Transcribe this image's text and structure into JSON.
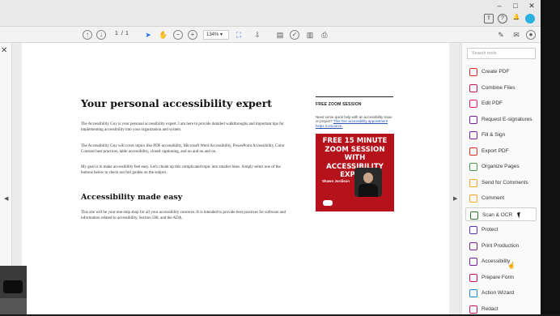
{
  "window": {
    "min": "–",
    "max": "□",
    "close": "✕"
  },
  "topbar_icons": [
    "share-icon",
    "help-icon",
    "bell-icon",
    "account-icon"
  ],
  "toolbar": {
    "page_current": "1",
    "page_sep": "/",
    "page_total": "1",
    "zoom": "134%"
  },
  "document": {
    "title": "Your personal accessibility expert",
    "para1": "The Accessibility Guy is your personal accessibility expert. I am here to provide detailed walkthroughs and important tips for implementing accessibility into your organization and system.",
    "para2": "The Accessibility Guy will cover topics like PDF accessibility, Microsoft Word Accessibility, PowerPoint Accessibility, Color Contrast best practices, table accessibility, closed captioning, and on and on and on.",
    "para3": "My goal is to make accessibility feel easy. Let's chunk up this complicated topic into smaller bites. Simply select one of the buttons below to check out full guides on the subject.",
    "subtitle": "Accessibility made easy",
    "para4": "This site will be your one-stop shop for all your accessibility concerns. It is intended to provide best practices for software and information related to accessibility, Section 508, and the ADA.",
    "side_heading": "FREE ZOOM SESSION",
    "side_text": "Need some quick help with an accessibility issue or project?",
    "side_link": "This free accessibility appointment helps it resource.",
    "promo_text": "FREE 15 MINUTE ZOOM SESSION WITH ACCESSIBILITY EXPERT",
    "promo_name": "Shawn Jordison"
  },
  "tools_panel": {
    "search_placeholder": "Search tools",
    "items": [
      {
        "label": "Create PDF",
        "color": "#d93025"
      },
      {
        "label": "Combine Files",
        "color": "#c2185b"
      },
      {
        "label": "Edit PDF",
        "color": "#e91e63"
      },
      {
        "label": "Request E-signatures",
        "color": "#7b1fa2"
      },
      {
        "label": "Fill & Sign",
        "color": "#7b1fa2"
      },
      {
        "label": "Export PDF",
        "color": "#d93025"
      },
      {
        "label": "Organize Pages",
        "color": "#43a047"
      },
      {
        "label": "Send for Comments",
        "color": "#f9a825"
      },
      {
        "label": "Comment",
        "color": "#f9a825"
      },
      {
        "label": "Scan & OCR",
        "color": "#2e7d32"
      },
      {
        "label": "Protect",
        "color": "#5e35b1"
      },
      {
        "label": "Print Production",
        "color": "#7b1fa2"
      },
      {
        "label": "Accessibility",
        "color": "#7b1fa2"
      },
      {
        "label": "Prepare Form",
        "color": "#c2185b"
      },
      {
        "label": "Action Wizard",
        "color": "#1e88e5"
      },
      {
        "label": "Redact",
        "color": "#c2185b"
      }
    ]
  }
}
